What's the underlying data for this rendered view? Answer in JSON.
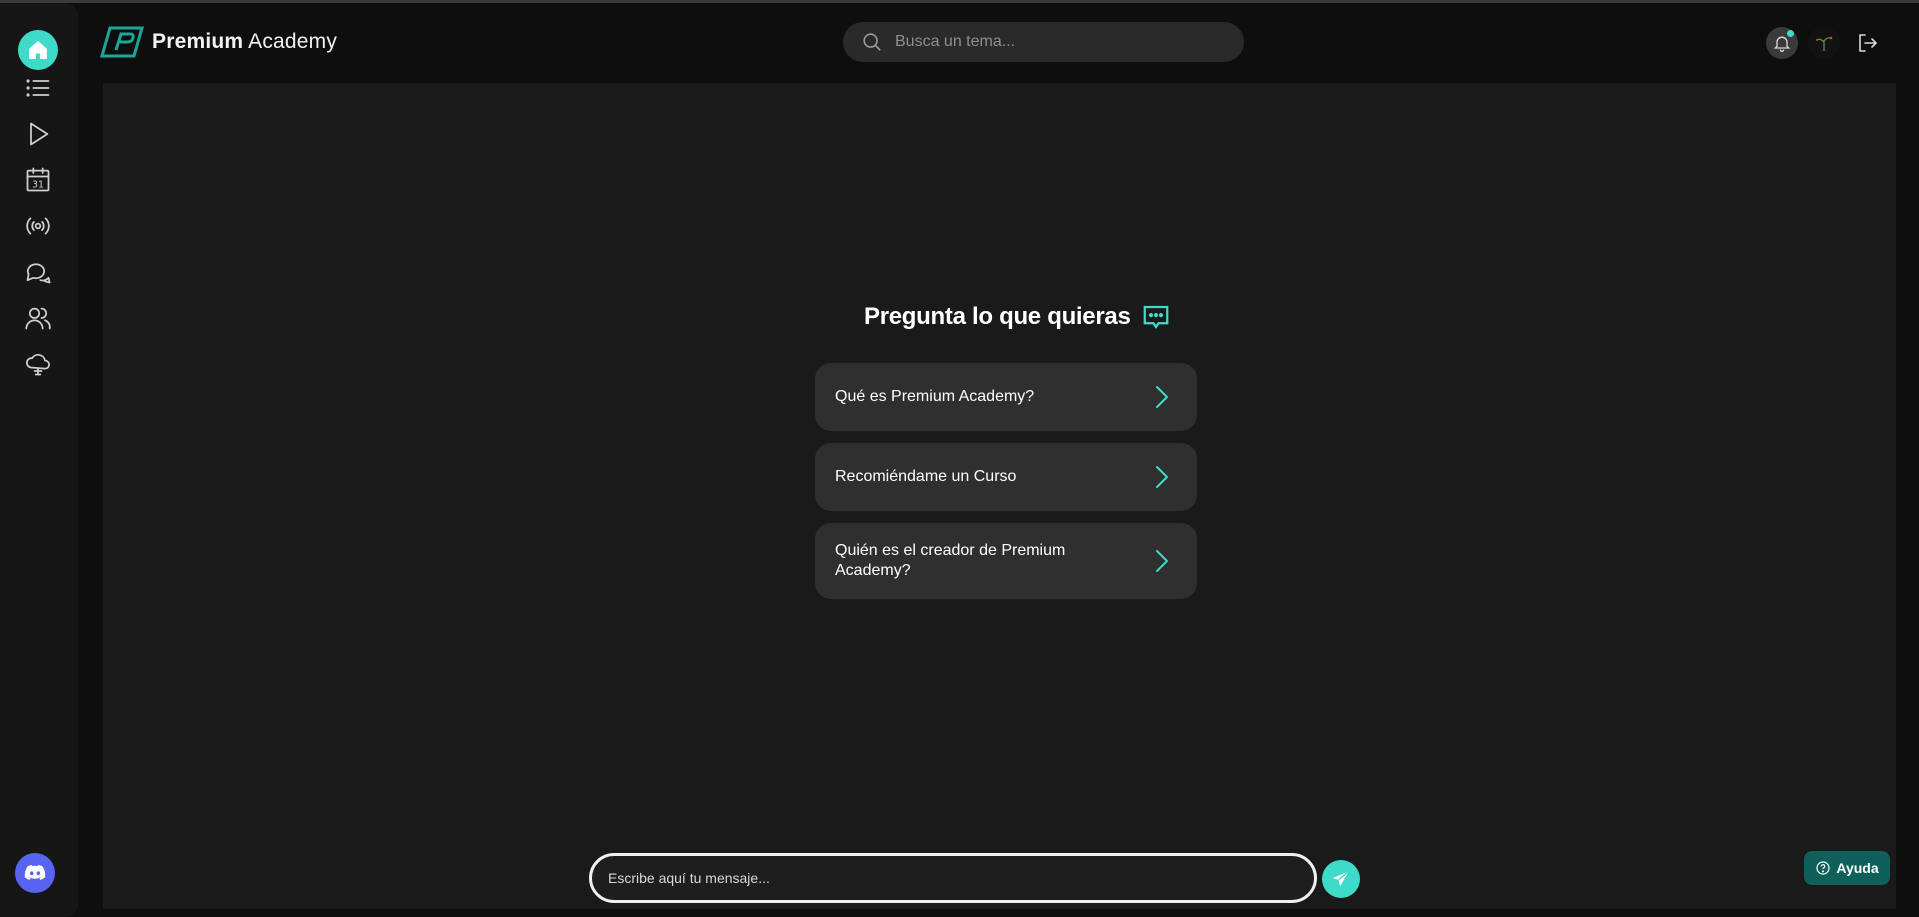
{
  "app": {
    "name_bold": "Premium",
    "name_rest": " Academy"
  },
  "sidebar": {
    "items": [
      {
        "icon": "home-icon",
        "active": true
      },
      {
        "icon": "list-icon"
      },
      {
        "icon": "play-icon"
      },
      {
        "icon": "calendar-icon",
        "calendar_day": "31"
      },
      {
        "icon": "broadcast-icon"
      },
      {
        "icon": "chat-bubbles-icon"
      },
      {
        "icon": "users-icon"
      },
      {
        "icon": "cloud-ai-icon"
      }
    ],
    "discord": {
      "icon": "discord-icon"
    }
  },
  "header": {
    "search_placeholder": "Busca un tema...",
    "notification_icon": "bell-icon",
    "logout_icon": "logout-icon"
  },
  "main": {
    "heading": "Pregunta lo que quieras",
    "heading_icon": "chat-dots-icon",
    "suggestions": [
      "Qué es Premium Academy?",
      "Recomiéndame un Curso",
      "Quién es el creador de Premium Academy?"
    ]
  },
  "chat": {
    "placeholder": "Escribe aquí tu mensaje...",
    "send_icon": "send-icon"
  },
  "help": {
    "label": "Ayuda",
    "icon": "question-circle-icon"
  },
  "colors": {
    "accent": "#3ddbc8",
    "background": "#0e0e0e",
    "panel": "#1a1a1a",
    "card": "#2f2f2f",
    "help_bg": "#0f5f5a",
    "discord": "#5865f2"
  }
}
